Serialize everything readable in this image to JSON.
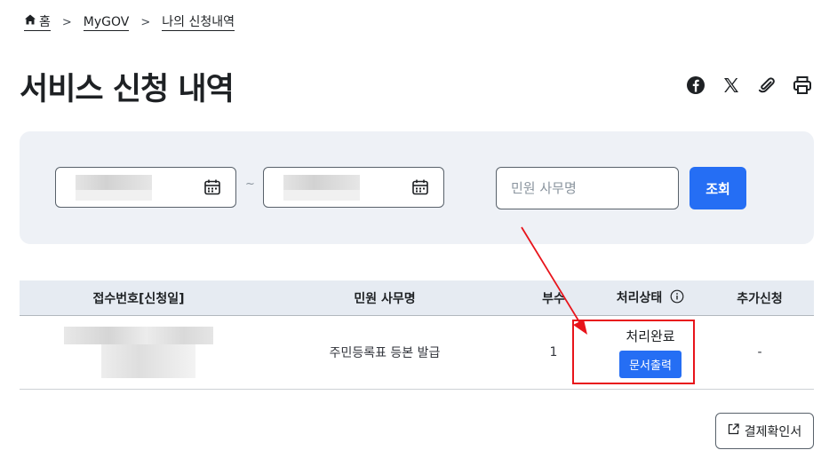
{
  "breadcrumb": {
    "items": [
      {
        "label": "홈",
        "icon": "home-icon"
      },
      {
        "label": "MyGOV"
      },
      {
        "label": "나의 신청내역"
      }
    ]
  },
  "page": {
    "title": "서비스 신청 내역",
    "share_icons": [
      "facebook-icon",
      "x-icon",
      "link-icon",
      "print-icon"
    ]
  },
  "search": {
    "start_date": "",
    "end_date": "",
    "range_separator": "~",
    "keyword_placeholder": "민원 사무명",
    "submit_label": "조회"
  },
  "table": {
    "headers": {
      "receipt": "접수번호[신청일]",
      "service": "민원 사무명",
      "copies": "부수",
      "status": "처리상태",
      "extra": "추가신청"
    },
    "rows": [
      {
        "receipt": "",
        "service": "주민등록표 등본 발급",
        "copies": "1",
        "status": "처리완료",
        "print_label": "문서출력",
        "extra": "-"
      }
    ]
  },
  "footer": {
    "confirm_label": "결제확인서"
  },
  "colors": {
    "primary": "#256ef4",
    "search_bg": "#eef1f6",
    "table_header_bg": "#e6ebf2",
    "annotation": "#e8141b"
  }
}
